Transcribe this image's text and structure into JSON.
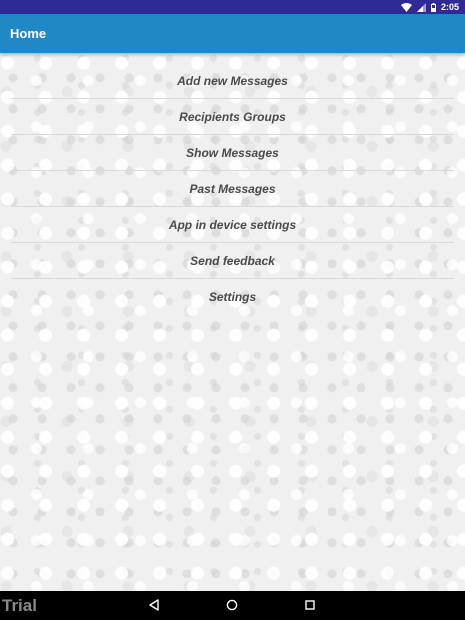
{
  "status_bar": {
    "time": "2:05",
    "icons": [
      "wifi-icon",
      "signal-icon",
      "battery-icon"
    ]
  },
  "app_bar": {
    "title": "Home"
  },
  "menu": {
    "items": [
      {
        "label": "Add new Messages"
      },
      {
        "label": "Recipients Groups"
      },
      {
        "label": "Show Messages"
      },
      {
        "label": "Past Messages"
      },
      {
        "label": "App in device settings"
      },
      {
        "label": "Send feedback"
      },
      {
        "label": "Settings"
      }
    ]
  },
  "nav_bar": {
    "buttons": [
      "back-icon",
      "home-icon",
      "recents-icon"
    ]
  },
  "watermark": {
    "text": "Trial"
  },
  "colors": {
    "status_bar": "#2f2b96",
    "app_bar": "#1f88c5",
    "menu_text": "#4a4a4a",
    "nav_bar": "#000000"
  }
}
